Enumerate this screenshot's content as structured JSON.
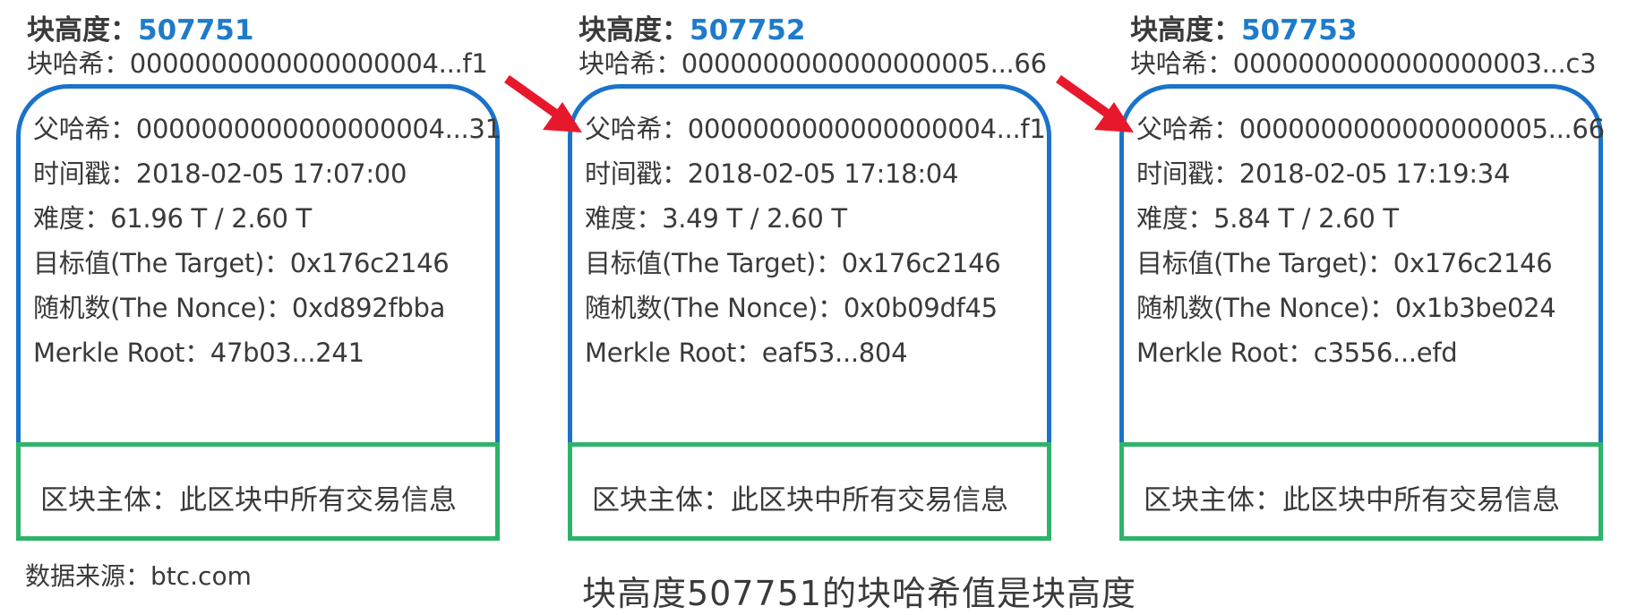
{
  "blocks": [
    {
      "height_label": "块高度：",
      "height_value": "507751",
      "hash": "块哈希：0000000000000000004...f1",
      "fields": [
        "父哈希：0000000000000000004...31",
        "时间戳：2018-02-05 17:07:00",
        "难度：61.96 T / 2.60 T",
        "目标值(The Target)：0x176c2146",
        "随机数(The Nonce)：0xd892fbba",
        "Merkle Root：47b03...241"
      ],
      "body": "区块主体：此区块中所有交易信息"
    },
    {
      "height_label": "块高度：",
      "height_value": "507752",
      "hash": "块哈希：0000000000000000005...66",
      "fields": [
        "父哈希：0000000000000000004...f1",
        "时间戳：2018-02-05 17:18:04",
        "难度：3.49 T / 2.60 T",
        "目标值(The Target)：0x176c2146",
        "随机数(The Nonce)：0x0b09df45",
        "Merkle Root：eaf53...804"
      ],
      "body": "区块主体：此区块中所有交易信息"
    },
    {
      "height_label": "块高度：",
      "height_value": "507753",
      "hash": "块哈希：0000000000000000003...c3",
      "fields": [
        "父哈希：0000000000000000005...66",
        "时间戳：2018-02-05 17:19:34",
        "难度：5.84 T / 2.60 T",
        "目标值(The Target)：0x176c2146",
        "随机数(The Nonce)：0x1b3be024",
        "Merkle Root：c3556...efd"
      ],
      "body": "区块主体：此区块中所有交易信息"
    }
  ],
  "source": "数据来源：btc.com",
  "caption": "块高度507751的块哈希值是块高度",
  "colors": {
    "header_border": "#1a73c9",
    "body_border": "#2eb46a",
    "height_value": "#1f7bc9",
    "arrow": "#e8182c"
  }
}
